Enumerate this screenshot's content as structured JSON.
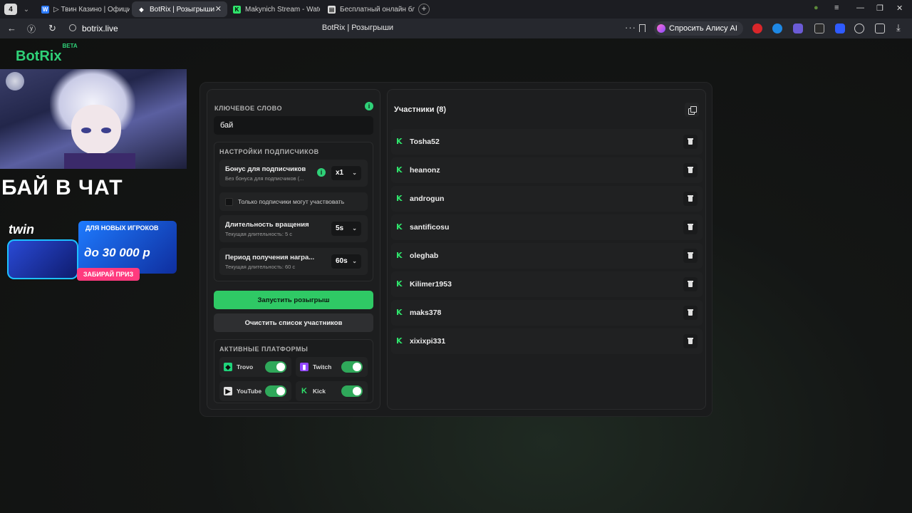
{
  "browser": {
    "tab_count": "4",
    "tabs": [
      {
        "label": "▷ Твин Казино | Официал"
      },
      {
        "label": "BotRix | Розыгрыши"
      },
      {
        "label": "Makynich Stream - Watch"
      },
      {
        "label": "Бесплатный онлайн блок"
      }
    ],
    "url": "botrix.live",
    "page_title": "BotRix | Розыгрыши",
    "alice_label": "Спросить Алису AI"
  },
  "site": {
    "logo": "BotRix",
    "logo_badge": "BETA"
  },
  "overlay": {
    "chat_text": "БАЙ В ЧАТ",
    "promo_brand": "twin",
    "promo_line1": "ДЛЯ НОВЫХ ИГРОКОВ",
    "promo_line2": "до 30 000 р",
    "promo_button": "ЗАБИРАЙ ПРИЗ"
  },
  "giveaway": {
    "keyword_label": "КЛЮЧЕВОЕ СЛОВО",
    "keyword_value": "бай",
    "subscriber_settings_label": "НАСТРОЙКИ ПОДПИСЧИКОВ",
    "bonus_title": "Бонус для подписчиков",
    "bonus_sub": "Без бонуса для подписчиков (...",
    "bonus_value": "x1",
    "subs_only_label": "Только подписчики могут участвовать",
    "spin_title": "Длительность вращения",
    "spin_sub": "Текущая длительность: 5 с",
    "spin_value": "5s",
    "reward_title": "Период получения награ...",
    "reward_sub": "Текущая длительность: 60 с",
    "reward_value": "60s",
    "start_button": "Запустить розыгрыш",
    "clear_button": "Очистить список участников",
    "platforms_label": "АКТИВНЫЕ ПЛАТФОРМЫ",
    "platforms": [
      {
        "name": "Trovo",
        "enabled": true
      },
      {
        "name": "Twitch",
        "enabled": true
      },
      {
        "name": "YouTube",
        "enabled": true
      },
      {
        "name": "Kick",
        "enabled": true
      }
    ]
  },
  "participants": {
    "title": "Участники (8)",
    "items": [
      {
        "name": "Tosha52"
      },
      {
        "name": "heanonz"
      },
      {
        "name": "androgun"
      },
      {
        "name": "santificosu"
      },
      {
        "name": "oleghab"
      },
      {
        "name": "Kilimer1953"
      },
      {
        "name": "maks378"
      },
      {
        "name": "xixixpi331"
      }
    ]
  },
  "colors": {
    "accent": "#2fc965",
    "kick_green": "#2fe36b",
    "background": "#121212"
  }
}
